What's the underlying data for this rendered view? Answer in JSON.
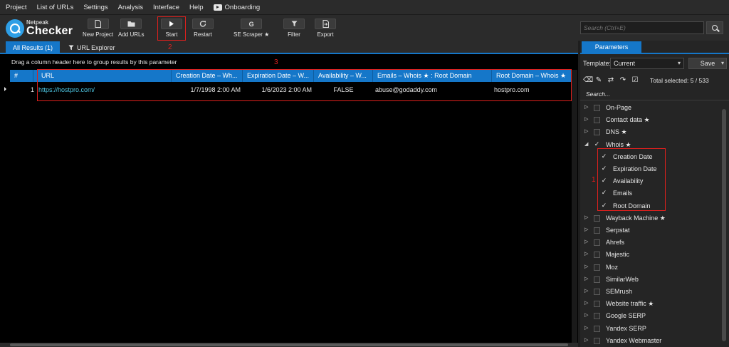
{
  "menu": [
    "Project",
    "List of URLs",
    "Settings",
    "Analysis",
    "Interface",
    "Help",
    "Onboarding"
  ],
  "logo": {
    "small": "Netpeak",
    "big": "Checker"
  },
  "toolbar": {
    "new_project": "New Project",
    "add_urls": "Add URLs",
    "start": "Start",
    "restart": "Restart",
    "se_scraper": "SE Scraper ★",
    "filter": "Filter",
    "export": "Export",
    "search_placeholder": "Search (Ctrl+E)"
  },
  "icons": {
    "new_project": "document-icon",
    "add_urls": "folder-icon",
    "start": "play-icon",
    "restart": "refresh-icon",
    "se_scraper": "google-icon",
    "filter": "filter-icon",
    "export": "export-icon",
    "search": "search-icon"
  },
  "tabs": {
    "all_results": "All Results (1)",
    "url_explorer": "URL Explorer"
  },
  "grid": {
    "group_hint": "Drag a column header here to group results by this parameter",
    "columns": [
      "#",
      "URL",
      "Creation Date – Wh...",
      "Expiration Date – W...",
      "Availability – W...",
      "Emails – Whois ★ : Root Domain",
      "Root Domain – Whois ★"
    ],
    "rows": [
      {
        "num": "1",
        "url": "https://hostpro.com/",
        "creation": "1/7/1998 2:00 AM",
        "expiration": "1/6/2023 2:00 AM",
        "availability": "FALSE",
        "emails": "abuse@godaddy.com",
        "root": "hostpro.com"
      }
    ]
  },
  "annotations": {
    "one": "1",
    "two": "2",
    "three": "3"
  },
  "panel": {
    "tab": "Parameters",
    "template_label": "Template:",
    "template_value": "Current",
    "save": "Save",
    "total_selected": "Total selected: 5 / 533",
    "search": "Search...",
    "tree": [
      {
        "label": "On-Page",
        "expanded": false,
        "checked": false
      },
      {
        "label": "Contact data ★",
        "expanded": false,
        "checked": false
      },
      {
        "label": "DNS ★",
        "expanded": false,
        "checked": false
      },
      {
        "label": "Whois ★",
        "expanded": true,
        "checked": true
      },
      {
        "label": "Creation Date",
        "child": true,
        "checked": true
      },
      {
        "label": "Expiration Date",
        "child": true,
        "checked": true
      },
      {
        "label": "Availability",
        "child": true,
        "checked": true
      },
      {
        "label": "Emails",
        "child": true,
        "checked": true
      },
      {
        "label": "Root Domain",
        "child": true,
        "checked": true
      },
      {
        "label": "Wayback Machine ★",
        "expanded": false,
        "checked": false
      },
      {
        "label": "Serpstat",
        "expanded": false,
        "checked": false
      },
      {
        "label": "Ahrefs",
        "expanded": false,
        "checked": false
      },
      {
        "label": "Majestic",
        "expanded": false,
        "checked": false
      },
      {
        "label": "Moz",
        "expanded": false,
        "checked": false
      },
      {
        "label": "SimilarWeb",
        "expanded": false,
        "checked": false
      },
      {
        "label": "SEMrush",
        "expanded": false,
        "checked": false
      },
      {
        "label": "Website traffic ★",
        "expanded": false,
        "checked": false
      },
      {
        "label": "Google SERP",
        "expanded": false,
        "checked": false
      },
      {
        "label": "Yandex SERP",
        "expanded": false,
        "checked": false
      },
      {
        "label": "Yandex Webmaster",
        "expanded": false,
        "checked": false
      }
    ]
  }
}
